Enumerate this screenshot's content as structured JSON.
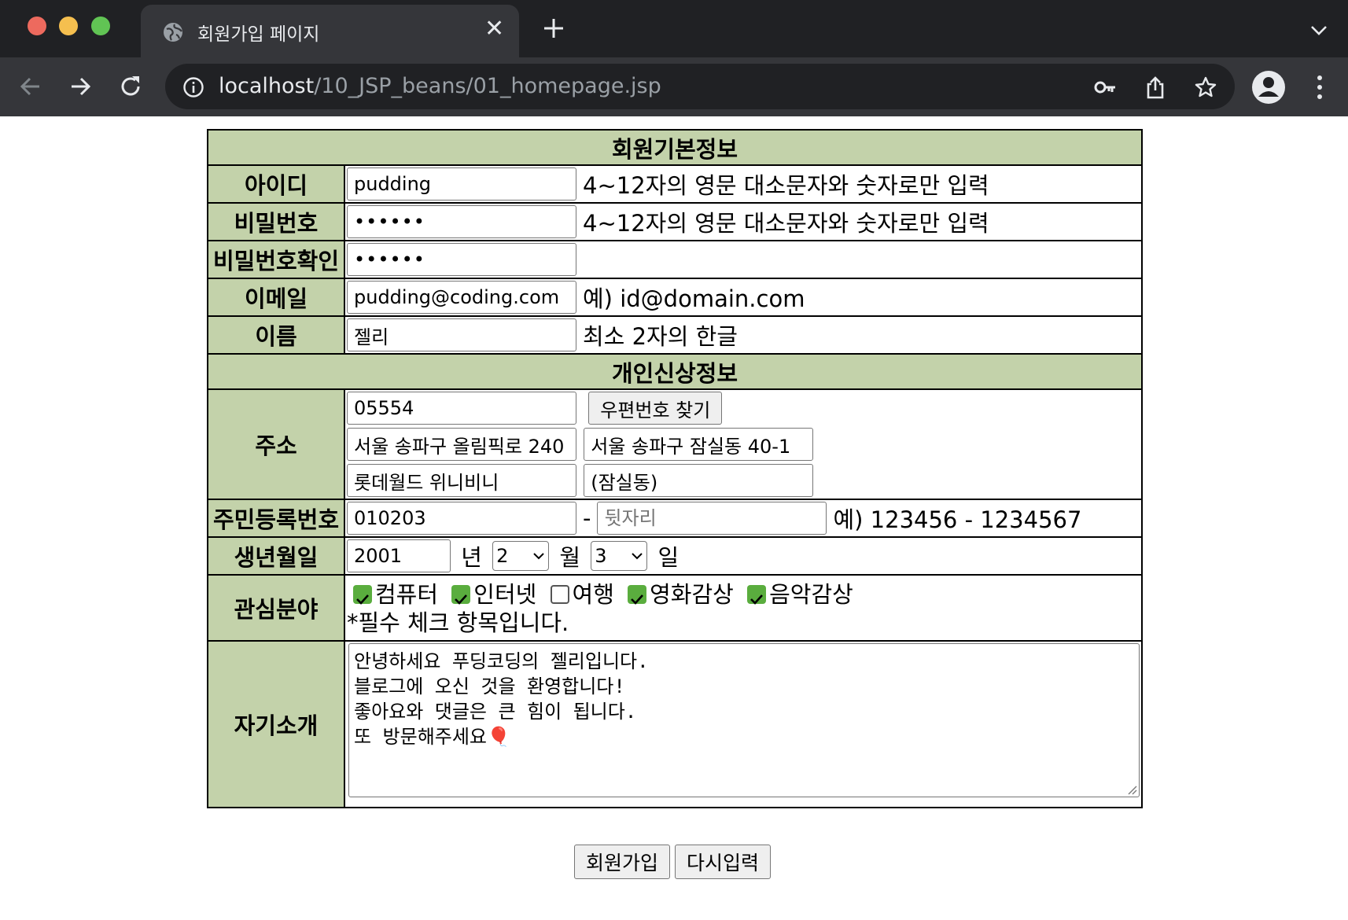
{
  "browser": {
    "tab_title": "회원가입 페이지",
    "url_host": "localhost",
    "url_path": "/10_JSP_beans/01_homepage.jsp",
    "traffic_colors": [
      "#ed6a5e",
      "#f5bf4f",
      "#61c454"
    ]
  },
  "sections": {
    "basic": "회원기본정보",
    "personal": "개인신상정보"
  },
  "fields": {
    "id": {
      "label": "아이디",
      "value": "pudding",
      "hint": "4~12자의 영문 대소문자와 숫자로만 입력"
    },
    "password": {
      "label": "비밀번호",
      "value": "••••••",
      "hint": "4~12자의 영문 대소문자와 숫자로만 입력"
    },
    "password_confirm": {
      "label": "비밀번호확인",
      "value": "••••••"
    },
    "email": {
      "label": "이메일",
      "value": "pudding@coding.com",
      "hint": "예) id@domain.com"
    },
    "name": {
      "label": "이름",
      "value": "젤리",
      "hint": "최소 2자의 한글"
    },
    "address": {
      "label": "주소",
      "zipcode": "05554",
      "zip_button": "우편번호 찾기",
      "road": "서울 송파구 올림픽로 240",
      "jibun": "서울 송파구 잠실동 40-1",
      "detail": "롯데월드 위니비니",
      "extra": "(잠실동)"
    },
    "ssn": {
      "label": "주민등록번호",
      "front": "010203",
      "dash": "-",
      "back_placeholder": "뒷자리",
      "hint": "예) 123456 - 1234567"
    },
    "birth": {
      "label": "생년월일",
      "year": "2001",
      "year_suffix": "년",
      "month": "2",
      "month_suffix": "월",
      "day": "3",
      "day_suffix": "일"
    },
    "interests": {
      "label": "관심분야",
      "items": [
        {
          "label": "컴퓨터",
          "checked": true
        },
        {
          "label": "인터넷",
          "checked": true
        },
        {
          "label": "여행",
          "checked": false
        },
        {
          "label": "영화감상",
          "checked": true
        },
        {
          "label": "음악감상",
          "checked": true
        }
      ],
      "note": "*필수 체크 항목입니다."
    },
    "intro": {
      "label": "자기소개",
      "text": "안녕하세요 푸딩코딩의 젤리입니다.\n블로그에 오신 것을 환영합니다!\n좋아요와 댓글은 큰 힘이 됩니다.\n또 방문해주세요🎈"
    }
  },
  "buttons": {
    "submit": "회원가입",
    "reset": "다시입력"
  },
  "colors": {
    "label_bg": "#c3d2aa",
    "checkbox_on": "#5aad3e"
  }
}
